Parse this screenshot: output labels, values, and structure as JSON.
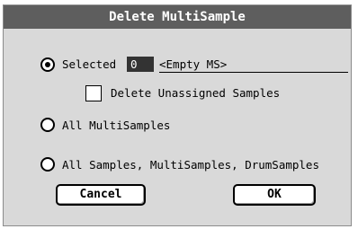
{
  "dialog": {
    "title": "Delete MultiSample",
    "options": [
      {
        "label": "Selected",
        "selected": true
      },
      {
        "label": "All MultiSamples",
        "selected": false
      },
      {
        "label": "All Samples, MultiSamples, DrumSamples",
        "selected": false
      }
    ],
    "selected_number": "0",
    "selected_name": "<Empty MS>",
    "delete_unassigned": {
      "label": "Delete Unassigned Samples",
      "checked": false
    },
    "cancel_label": "Cancel",
    "ok_label": "OK"
  }
}
